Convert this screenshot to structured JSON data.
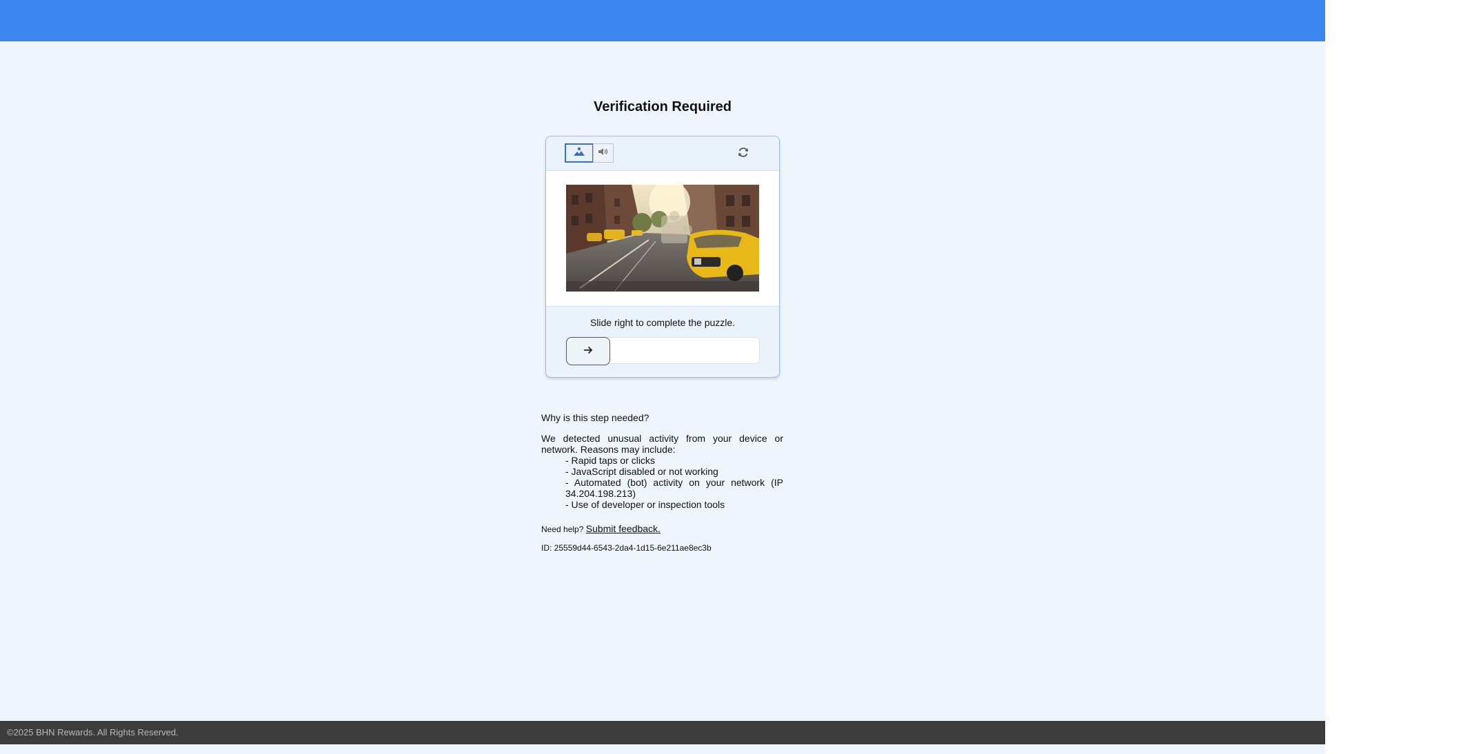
{
  "header": {},
  "main": {
    "title": "Verification Required",
    "captcha": {
      "modes": [
        {
          "icon": "image-icon",
          "active": true
        },
        {
          "icon": "audio-icon",
          "active": false
        }
      ],
      "refresh_icon": "refresh-icon",
      "instruction": "Slide right to complete the puzzle.",
      "slider_icon": "arrow-right-icon"
    },
    "info": {
      "question": "Why is this step needed?",
      "paragraph": "We detected unusual activity from your device or network. Reasons may include:",
      "reasons": [
        "- Rapid taps or clicks",
        "- JavaScript disabled or not working",
        "- Automated (bot) activity on your network (IP 34.204.198.213)",
        "- Use of developer or inspection tools"
      ]
    },
    "help": {
      "prefix": "Need help?",
      "link": "Submit feedback."
    },
    "request_id": "ID: 25559d44-6543-2da4-1d15-6e211ae8ec3b"
  },
  "footer": {
    "copyright": "©2025 BHN Rewards. All Rights Reserved."
  },
  "colors": {
    "topbar": "#3b86f0",
    "page_bg": "#eef5fd",
    "footer_bg": "#3c3c3c",
    "accent": "#3b6fc0"
  }
}
